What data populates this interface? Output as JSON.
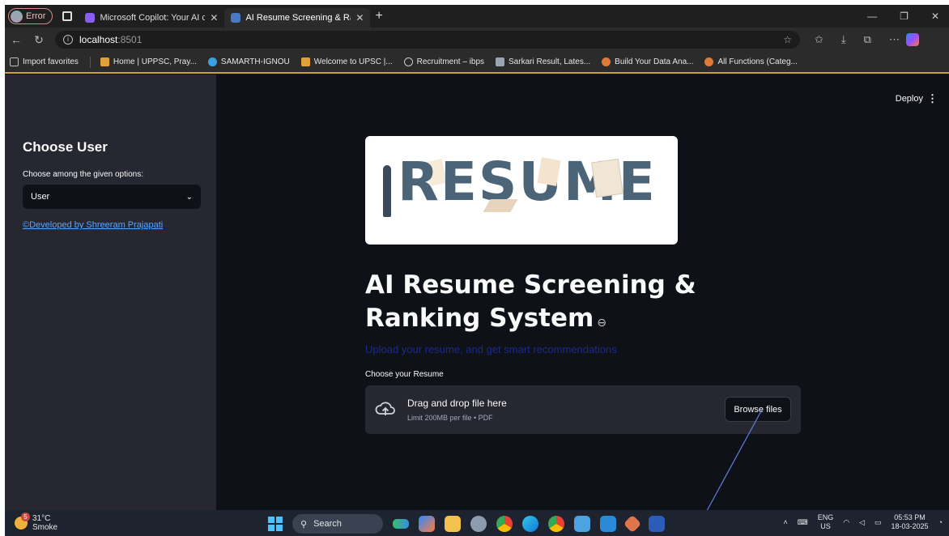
{
  "browser": {
    "profile": {
      "label": "Error"
    },
    "tabs": [
      {
        "title": "Microsoft Copilot: Your AI compa",
        "active": false,
        "favicon_color": "#8a5cf6"
      },
      {
        "title": "AI Resume Screening & Ranking S",
        "active": true,
        "favicon_color": "#4a78c2"
      }
    ],
    "new_tab": "+",
    "address": {
      "host": "localhost",
      "port": ":8501"
    },
    "favorites": [
      {
        "label": "Import favorites",
        "icon_color": "#bbbbbb"
      },
      {
        "label": "Home | UPPSC, Pray...",
        "icon_color": "#e0a13a"
      },
      {
        "label": "SAMARTH-IGNOU",
        "icon_color": "#3aa0e0"
      },
      {
        "label": "Welcome to UPSC |...",
        "icon_color": "#e0a13a"
      },
      {
        "label": "Recruitment – ibps",
        "icon_color": "#cccccc"
      },
      {
        "label": "Sarkari Result, Lates...",
        "icon_color": "#9aa4b2"
      },
      {
        "label": "Build Your Data Ana...",
        "icon_color": "#e07a3a"
      },
      {
        "label": "All Functions (Categ...",
        "icon_color": "#e07a3a"
      }
    ]
  },
  "sidebar": {
    "title": "Choose User",
    "select_label": "Choose among the given options:",
    "selected": "User",
    "dev_link": "©Developed by Shreeram Prajapati"
  },
  "header": {
    "deploy": "Deploy"
  },
  "banner": {
    "word": "RESUME"
  },
  "main": {
    "title": "AI Resume Screening & Ranking System",
    "subtitle": "Upload your resume, and get smart recommendations",
    "upload_label": "Choose your Resume",
    "dropzone_main": "Drag and drop file here",
    "dropzone_sub": "Limit 200MB per file • PDF",
    "browse": "Browse files"
  },
  "colors": {
    "app_bg": "#0e1117",
    "sidebar_bg": "#262730",
    "link": "#5aa6ff",
    "subtitle": "#1c2a8a"
  },
  "taskbar": {
    "weather": {
      "temp": "31°C",
      "desc": "Smoke",
      "badge": "5"
    },
    "search": "Search",
    "lang": [
      "ENG",
      "US"
    ],
    "time": "05:53 PM",
    "date": "18-03-2025"
  }
}
